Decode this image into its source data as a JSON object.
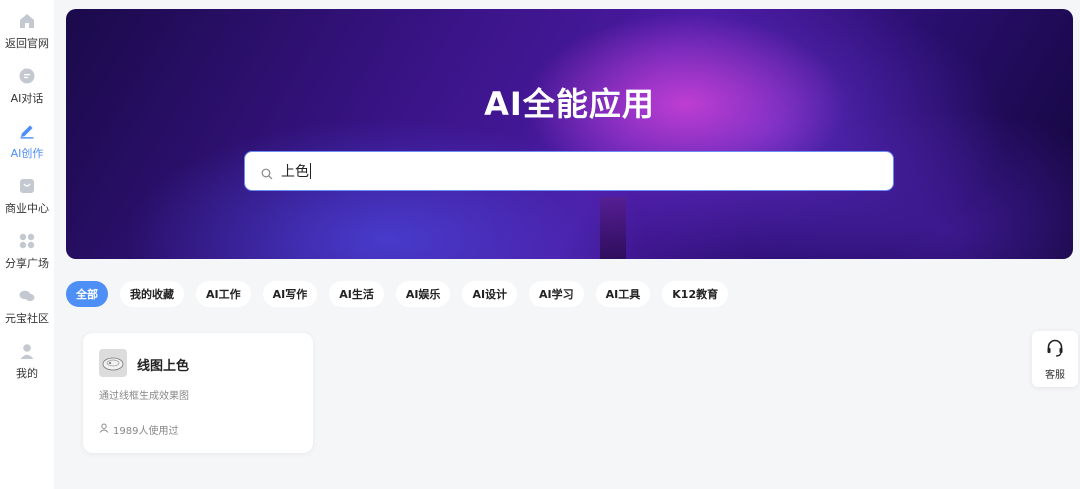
{
  "sidebar": {
    "items": [
      {
        "label": "返回官网",
        "icon": "home-icon",
        "active": false
      },
      {
        "label": "AI对话",
        "icon": "chat-icon",
        "active": false
      },
      {
        "label": "AI创作",
        "icon": "pencil-icon",
        "active": true
      },
      {
        "label": "商业中心",
        "icon": "store-icon",
        "active": false
      },
      {
        "label": "分享广场",
        "icon": "grid-icon",
        "active": false
      },
      {
        "label": "元宝社区",
        "icon": "community-icon",
        "active": false
      },
      {
        "label": "我的",
        "icon": "user-icon",
        "active": false
      }
    ]
  },
  "hero": {
    "title": "AI全能应用"
  },
  "search": {
    "value": "上色"
  },
  "tabs": [
    {
      "label": "全部",
      "active": true
    },
    {
      "label": "我的收藏",
      "active": false
    },
    {
      "label": "AI工作",
      "active": false
    },
    {
      "label": "AI写作",
      "active": false
    },
    {
      "label": "AI生活",
      "active": false
    },
    {
      "label": "AI娱乐",
      "active": false
    },
    {
      "label": "AI设计",
      "active": false
    },
    {
      "label": "AI学习",
      "active": false
    },
    {
      "label": "AI工具",
      "active": false
    },
    {
      "label": "K12教育",
      "active": false
    }
  ],
  "card": {
    "title": "线图上色",
    "description": "通过线框生成效果图",
    "usage": "1989人使用过"
  },
  "service": {
    "label": "客服"
  },
  "colors": {
    "accent": "#4d8ef7",
    "icon_gray": "#c4c8d0"
  }
}
